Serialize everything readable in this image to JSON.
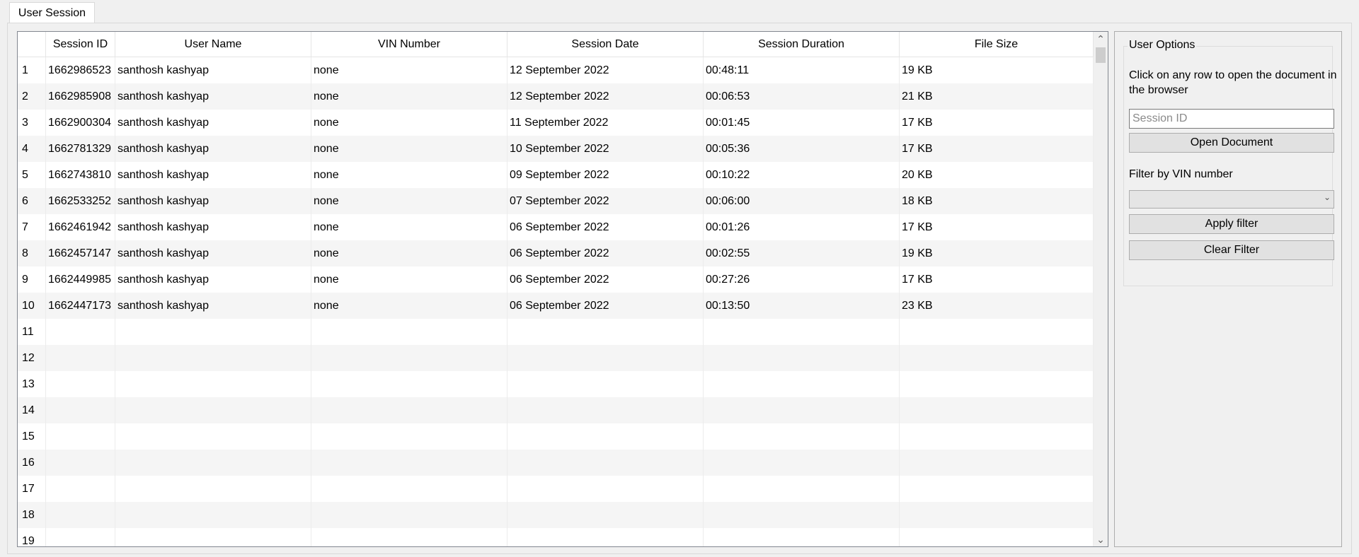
{
  "tab": {
    "label": "User Session"
  },
  "table": {
    "columns": [
      "Session ID",
      "User Name",
      "VIN Number",
      "Session Date",
      "Session Duration",
      "File Size"
    ],
    "rows": [
      [
        "1662986523",
        "santhosh kashyap",
        "none",
        "12 September 2022",
        "00:48:11",
        "19 KB"
      ],
      [
        "1662985908",
        "santhosh kashyap",
        "none",
        "12 September 2022",
        "00:06:53",
        "21 KB"
      ],
      [
        "1662900304",
        "santhosh kashyap",
        "none",
        "11 September 2022",
        "00:01:45",
        "17 KB"
      ],
      [
        "1662781329",
        "santhosh kashyap",
        "none",
        "10 September 2022",
        "00:05:36",
        "17 KB"
      ],
      [
        "1662743810",
        "santhosh kashyap",
        "none",
        "09 September 2022",
        "00:10:22",
        "20 KB"
      ],
      [
        "1662533252",
        "santhosh kashyap",
        "none",
        "07 September 2022",
        "00:06:00",
        "18 KB"
      ],
      [
        "1662461942",
        "santhosh kashyap",
        "none",
        "06 September 2022",
        "00:01:26",
        "17 KB"
      ],
      [
        "1662457147",
        "santhosh kashyap",
        "none",
        "06 September 2022",
        "00:02:55",
        "19 KB"
      ],
      [
        "1662449985",
        "santhosh kashyap",
        "none",
        "06 September 2022",
        "00:27:26",
        "17 KB"
      ],
      [
        "1662447173",
        "santhosh kashyap",
        "none",
        "06 September 2022",
        "00:13:50",
        "23 KB"
      ]
    ],
    "row_numbers": [
      "1",
      "2",
      "3",
      "4",
      "5",
      "6",
      "7",
      "8",
      "9",
      "10",
      "11",
      "12",
      "13",
      "14",
      "15",
      "16",
      "17",
      "18",
      "19"
    ],
    "scroll_up_icon": "chevron-up-icon",
    "scroll_down_icon": "chevron-down-icon"
  },
  "options": {
    "title": "User Options",
    "hint": "Click on any row to open the document in the browser",
    "session_id_placeholder": "Session ID",
    "open_document_label": "Open Document",
    "filter_label": "Filter by VIN number",
    "filter_selected": "",
    "apply_filter_label": "Apply filter",
    "clear_filter_label": "Clear Filter"
  }
}
